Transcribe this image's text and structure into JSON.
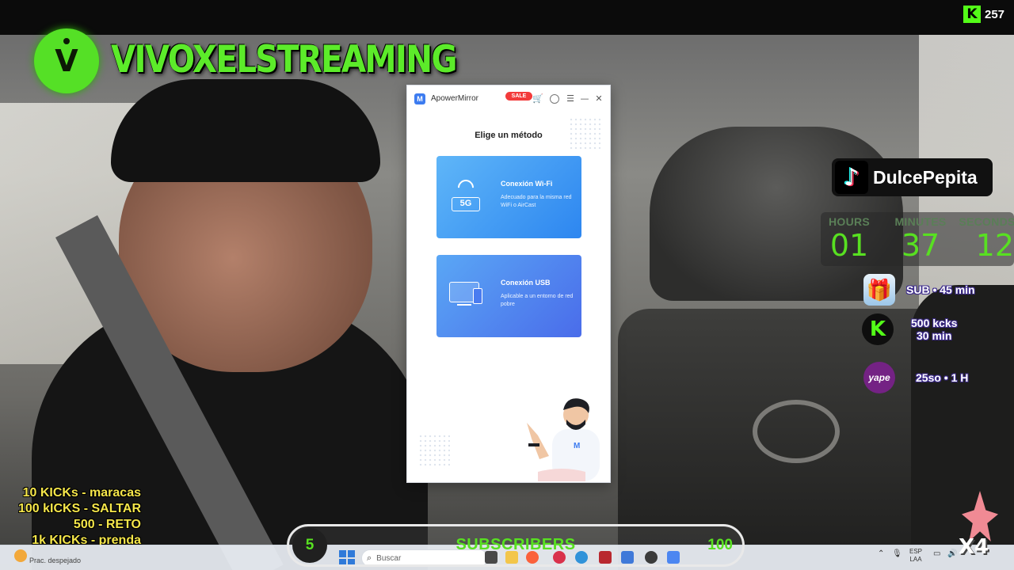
{
  "overlay": {
    "channel_name": "VIVOXELSTREAMING",
    "viewer_count": "257",
    "tiktok_user": "DulcePepita",
    "timer": {
      "hours_label": "HOURS",
      "hours": "01",
      "minutes_label": "MINUTES",
      "minutes": "37",
      "seconds_label": "SECONDS",
      "seconds": "12"
    },
    "rewards": [
      {
        "icon": "gift-icon",
        "text": "SUB • 45 min"
      },
      {
        "icon": "kick-icon",
        "line1": "500 kcks",
        "line2": "30 min"
      },
      {
        "icon": "yape-icon",
        "icon_text": "yape",
        "text": "25so • 1 H"
      }
    ],
    "kicks_menu": [
      "10 KICKs - maracas",
      "100 kICKS - SALTAR",
      "500 - RETO",
      "1k KICKs - prenda"
    ],
    "subscribers": {
      "current": "5",
      "label": "SUBSCRIBERS",
      "goal": "100"
    },
    "multiplier": "X4",
    "colors": {
      "accent_green": "#58e021",
      "kick_green": "#53fc18"
    }
  },
  "app": {
    "title": "ApowerMirror",
    "sale_badge": "SALE",
    "heading": "Elige un método",
    "methods": [
      {
        "title": "Conexión Wi-Fi",
        "desc": "Adecuado para la misma red WiFi o AirCast",
        "badge": "5G"
      },
      {
        "title": "Conexión USB",
        "desc": "Aplicable a un entorno de red pobre"
      }
    ],
    "colors": {
      "brand_blue": "#3d7cf0",
      "sale_red": "#f33b3b"
    }
  },
  "taskbar": {
    "weather_condition": "Prac. despejado",
    "search_placeholder": "Buscar",
    "language_line1": "ESP",
    "language_line2": "LAA"
  }
}
